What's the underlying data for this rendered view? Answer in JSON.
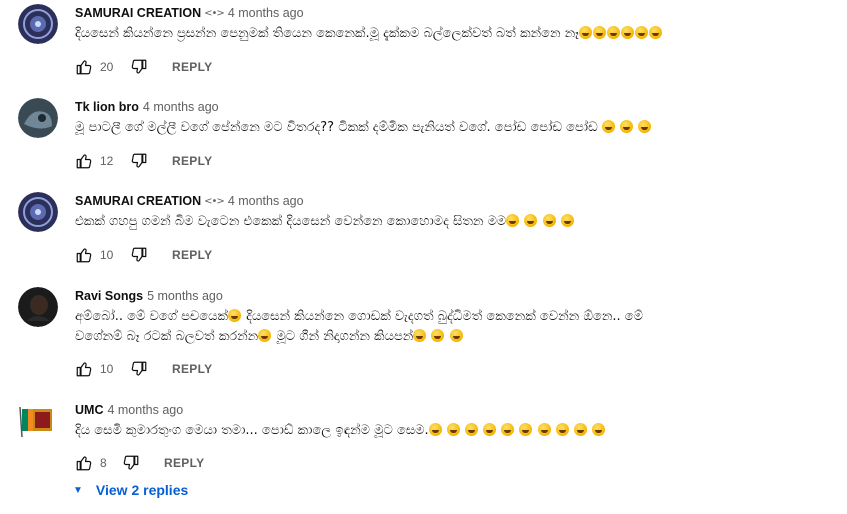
{
  "comments": [
    {
      "author": "SAMURAI CREATION",
      "badge": "<•>",
      "time": "4 months ago",
      "text": "දියසෙන් කියන්නෙ ප්‍රසන්න පෙනුමක් තියෙන කෙනෙක්.මූ දැක්කම බල්ලෙක්වත් බත් කන්නෙ නෑ",
      "emoji_count": 6,
      "likes": "20",
      "reply_label": "REPLY",
      "avatar_color": "#2c2f5a"
    },
    {
      "author": "Tk lion bro",
      "badge": "",
      "time": "4 months ago",
      "text": "මූ පාටලී ගේ මල්ලී වගේ පේන්නෙ මට විතරද?? ටිකක් දම්මික පැනියත් වගේ. පෝඩ පෝඩ පෝඩ",
      "emoji_count": 3,
      "likes": "12",
      "reply_label": "REPLY",
      "avatar_color": "#3a4a55"
    },
    {
      "author": "SAMURAI CREATION",
      "badge": "<•>",
      "time": "4 months ago",
      "text": "එකක් ගහපු ගමන් බිම වැටෙන එකෙක් දියසෙන් වෙන්නෙ කොහොමද සිතන මම",
      "emoji_count": 4,
      "likes": "10",
      "reply_label": "REPLY",
      "avatar_color": "#2c2f5a"
    },
    {
      "author": "Ravi Songs",
      "badge": "",
      "time": "5 months ago",
      "text_line1": "අම්බෝ.. මේ වගේ පච‍යෙක්",
      "text_line1b": " දියසෙන් කියන්නෙ ගොඩක් වැදගත් බුද්ධිමත් කෙනෙක් වෙන්න ඕනෙ.. මේ",
      "text_line2": "වගේනම් බෑ රටක් බලවත් කරන්න",
      "text_line2b": " මූට ගීන් නිදාගන්න කියපන්",
      "emoji_count": 3,
      "likes": "10",
      "reply_label": "REPLY",
      "avatar_color": "#1b1b1b"
    },
    {
      "author": "UMC",
      "badge": "",
      "time": "4 months ago",
      "text": "දිය සෙමි කුමාරතුංග මෙයා තමා... පොඩ් කාලෙ ඉඳන්ම මූට සෙම.",
      "emoji_count": 10,
      "likes": "8",
      "reply_label": "REPLY",
      "avatar_color": "#c98a1a"
    }
  ],
  "view_replies": "View 2 replies",
  "colors": {
    "link": "#065fd4",
    "meta": "#606060",
    "text": "#0f0f0f"
  }
}
